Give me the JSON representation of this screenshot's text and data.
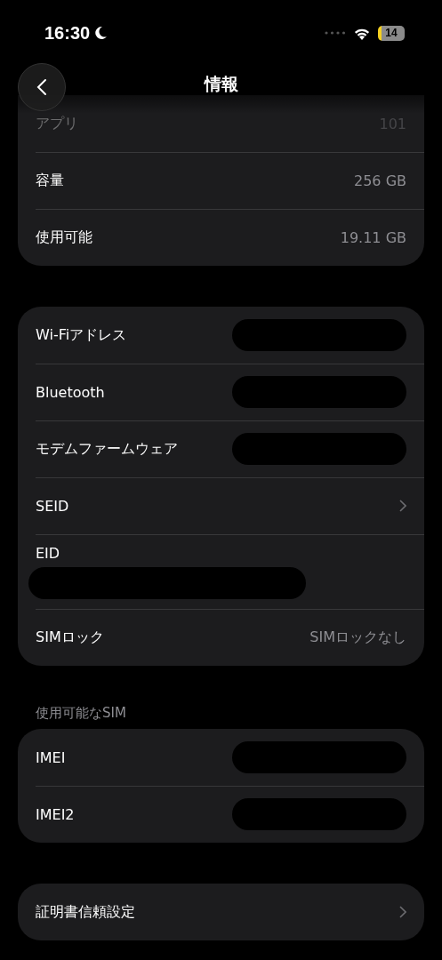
{
  "status_bar": {
    "time": "16:30",
    "battery": "14"
  },
  "nav": {
    "title": "情報"
  },
  "groups": [
    {
      "rows": [
        {
          "label": "アプリ",
          "value": "101",
          "faded": true
        },
        {
          "label": "容量",
          "value": "256 GB"
        },
        {
          "label": "使用可能",
          "value": "19.11 GB"
        }
      ]
    },
    {
      "rows": [
        {
          "label": "Wi-Fiアドレス",
          "redacted": true
        },
        {
          "label": "Bluetooth",
          "redacted": true
        },
        {
          "label": "モデムファームウェア",
          "redacted": true
        },
        {
          "label": "SEID",
          "chevron": true
        },
        {
          "label": "EID",
          "redacted": true,
          "stacked": true
        },
        {
          "label": "SIMロック",
          "value": "SIMロックなし"
        }
      ]
    },
    {
      "header": "使用可能なSIM",
      "rows": [
        {
          "label": "IMEI",
          "redacted": true
        },
        {
          "label": "IMEI2",
          "redacted": true
        }
      ]
    },
    {
      "rows": [
        {
          "label": "証明書信頼設定",
          "chevron": true
        }
      ]
    }
  ]
}
